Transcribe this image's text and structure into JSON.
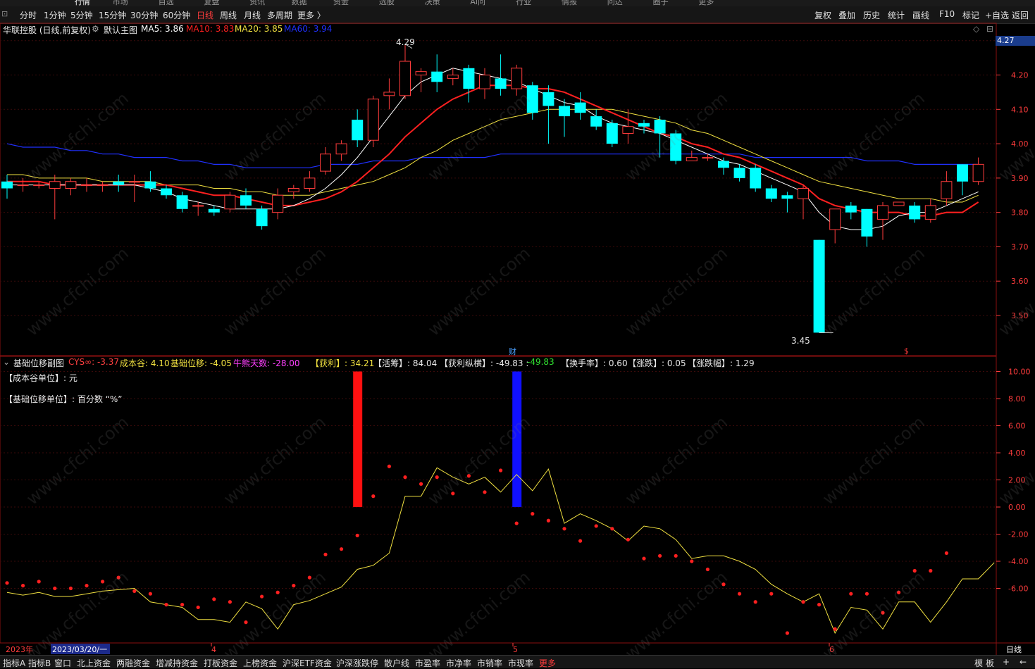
{
  "top_menu": [
    "行情",
    "市场",
    "自选",
    "复盘",
    "资讯",
    "数据",
    "资金",
    "选股",
    "决策",
    "Ai问",
    "行业",
    "情报",
    "问达",
    "圈子",
    "更多"
  ],
  "period_bar": {
    "items": [
      {
        "label": "分时",
        "active": false
      },
      {
        "label": "1分钟",
        "active": false
      },
      {
        "label": "5分钟",
        "active": false
      },
      {
        "label": "15分钟",
        "active": false
      },
      {
        "label": "30分钟",
        "active": false
      },
      {
        "label": "60分钟",
        "active": false
      },
      {
        "label": "日线",
        "active": true
      },
      {
        "label": "周线",
        "active": false
      },
      {
        "label": "月线",
        "active": false
      },
      {
        "label": "多周期",
        "active": false
      },
      {
        "label": "更多 〉",
        "active": false
      }
    ],
    "right": [
      "复权",
      "叠加",
      "历史",
      "统计",
      "画线",
      "F10",
      "标记",
      "+自选",
      "返回"
    ]
  },
  "info_bar": {
    "stock": "华联控股 (日线,前复权)",
    "template": "默认主图",
    "ma5": "MA5: 3.86",
    "ma10": "MA10: 3.83",
    "ma20": "MA20: 3.85",
    "ma60": "MA60: 3.94",
    "ma5_color": "#ffffff",
    "ma10_color": "#ff2020",
    "ma20_color": "#f0e040",
    "ma60_color": "#2030ff"
  },
  "sub_info": {
    "title": "基础位移副图",
    "cys": "CYS∞: -3.37",
    "cost_valley": "成本谷: 4.10",
    "base_shift": "基础位移: -4.05",
    "bear_days": "牛熊天数: -28.00",
    "profit": "【获利】: 34.21",
    "active": "【活筹】: 84.04",
    "profit_vh": "【获利纵横】: -49.83 : ",
    "profit_vh2": "-49.83",
    "turnover": "【换手率】: 0.60",
    "change": "【涨跌】: 0.05",
    "change_pct": "【涨跌幅】: 1.29",
    "unit1": "【成本谷单位】: 元",
    "unit2": "【基础位移单位】: 百分数 “%”"
  },
  "markers": {
    "high": "4.29",
    "low": "3.45",
    "cai": "财",
    "dollar": "$",
    "current_price": "4.27"
  },
  "bottom_bar": {
    "tabs": [
      "指标A",
      "指标B",
      "窗口",
      "北上资金",
      "两融资金",
      "增减持资金",
      "打板资金",
      "上榜资金",
      "沪深ETF资金",
      "沪深涨跌停",
      "散户线",
      "市盈率",
      "市净率",
      "市销率",
      "市现率",
      "更多"
    ],
    "right": [
      "模",
      "板",
      "+",
      "←"
    ]
  },
  "watermark": "www.cfchi.com",
  "chart_data": [
    {
      "type": "candlestick",
      "title": "华联控股 (日线,前复权)",
      "ylim": [
        3.42,
        4.32
      ],
      "yticks": [
        "4.30",
        "4.20",
        "4.10",
        "4.00",
        "3.90",
        "3.80",
        "3.70",
        "3.60",
        "3.50"
      ],
      "ytick_values": [
        4.3,
        4.2,
        4.1,
        4.0,
        3.9,
        3.8,
        3.7,
        3.6,
        3.5
      ],
      "x_labels": [
        "2023年",
        "2023/03/20/一",
        "4",
        "5",
        "6",
        "日线"
      ],
      "candles": [
        [
          3.89,
          3.87,
          3.91,
          3.84
        ],
        [
          3.88,
          3.88,
          3.9,
          3.86
        ],
        [
          3.88,
          3.88,
          3.89,
          3.87
        ],
        [
          3.87,
          3.89,
          3.91,
          3.78
        ],
        [
          3.87,
          3.89,
          3.9,
          3.85
        ],
        [
          3.88,
          3.88,
          3.9,
          3.86
        ],
        [
          3.88,
          3.88,
          3.89,
          3.86
        ],
        [
          3.89,
          3.88,
          3.91,
          3.86
        ],
        [
          3.89,
          3.89,
          3.91,
          3.83
        ],
        [
          3.89,
          3.87,
          3.92,
          3.86
        ],
        [
          3.87,
          3.85,
          3.88,
          3.84
        ],
        [
          3.85,
          3.81,
          3.86,
          3.8
        ],
        [
          3.82,
          3.82,
          3.83,
          3.79
        ],
        [
          3.81,
          3.8,
          3.82,
          3.79
        ],
        [
          3.81,
          3.85,
          3.86,
          3.8
        ],
        [
          3.85,
          3.82,
          3.87,
          3.81
        ],
        [
          3.81,
          3.76,
          3.82,
          3.75
        ],
        [
          3.8,
          3.85,
          3.87,
          3.78
        ],
        [
          3.86,
          3.87,
          3.88,
          3.84
        ],
        [
          3.87,
          3.9,
          3.92,
          3.86
        ],
        [
          3.92,
          3.97,
          3.99,
          3.91
        ],
        [
          3.97,
          4.0,
          4.01,
          3.95
        ],
        [
          4.07,
          4.01,
          4.1,
          3.99
        ],
        [
          4.01,
          4.13,
          4.14,
          3.99
        ],
        [
          4.14,
          4.15,
          4.19,
          4.1
        ],
        [
          4.14,
          4.24,
          4.29,
          4.13
        ],
        [
          4.2,
          4.21,
          4.22,
          4.15
        ],
        [
          4.21,
          4.18,
          4.26,
          4.15
        ],
        [
          4.19,
          4.2,
          4.22,
          4.17
        ],
        [
          4.22,
          4.16,
          4.23,
          4.12
        ],
        [
          4.16,
          4.2,
          4.22,
          4.13
        ],
        [
          4.19,
          4.16,
          4.26,
          4.14
        ],
        [
          4.16,
          4.22,
          4.23,
          4.14
        ],
        [
          4.17,
          4.09,
          4.18,
          4.07
        ],
        [
          4.15,
          4.11,
          4.17,
          4.0
        ],
        [
          4.11,
          4.08,
          4.13,
          4.02
        ],
        [
          4.12,
          4.09,
          4.15,
          4.07
        ],
        [
          4.08,
          4.05,
          4.1,
          4.04
        ],
        [
          4.06,
          4.0,
          4.07,
          3.99
        ],
        [
          4.03,
          4.05,
          4.1,
          4.0
        ],
        [
          4.06,
          4.05,
          4.07,
          4.03
        ],
        [
          4.07,
          4.03,
          4.08,
          3.96
        ],
        [
          4.03,
          3.95,
          4.04,
          3.94
        ],
        [
          3.95,
          3.96,
          3.98,
          3.95
        ],
        [
          3.96,
          3.96,
          3.97,
          3.95
        ],
        [
          3.95,
          3.93,
          3.96,
          3.91
        ],
        [
          3.93,
          3.9,
          3.94,
          3.89
        ],
        [
          3.93,
          3.87,
          3.94,
          3.86
        ],
        [
          3.87,
          3.84,
          3.88,
          3.83
        ],
        [
          3.85,
          3.84,
          3.86,
          3.8
        ],
        [
          3.84,
          3.87,
          3.88,
          3.78
        ],
        [
          3.72,
          3.45,
          3.72,
          3.45
        ],
        [
          3.75,
          3.81,
          3.81,
          3.71
        ],
        [
          3.82,
          3.8,
          3.83,
          3.78
        ],
        [
          3.81,
          3.73,
          3.81,
          3.7
        ],
        [
          3.78,
          3.82,
          3.83,
          3.72
        ],
        [
          3.82,
          3.83,
          3.83,
          3.82
        ],
        [
          3.82,
          3.78,
          3.83,
          3.77
        ],
        [
          3.78,
          3.82,
          3.84,
          3.77
        ],
        [
          3.84,
          3.89,
          3.92,
          3.82
        ],
        [
          3.94,
          3.89,
          3.94,
          3.85
        ],
        [
          3.89,
          3.94,
          3.96,
          3.88
        ]
      ],
      "ma5": [
        3.88,
        3.88,
        3.88,
        3.88,
        3.88,
        3.88,
        3.88,
        3.88,
        3.88,
        3.87,
        3.86,
        3.84,
        3.83,
        3.82,
        3.81,
        3.81,
        3.81,
        3.81,
        3.82,
        3.84,
        3.87,
        3.91,
        3.96,
        4.02,
        4.08,
        4.14,
        4.18,
        4.2,
        4.22,
        4.21,
        4.2,
        4.19,
        4.18,
        4.16,
        4.14,
        4.12,
        4.11,
        4.08,
        4.06,
        4.05,
        4.04,
        4.03,
        4.01,
        3.99,
        3.97,
        3.95,
        3.94,
        3.92,
        3.9,
        3.88,
        3.86,
        3.8,
        3.76,
        3.75,
        3.75,
        3.76,
        3.79,
        3.8,
        3.8,
        3.82,
        3.84,
        3.86
      ],
      "ma10": [
        3.89,
        3.89,
        3.89,
        3.88,
        3.88,
        3.88,
        3.88,
        3.88,
        3.88,
        3.88,
        3.88,
        3.87,
        3.86,
        3.85,
        3.85,
        3.84,
        3.83,
        3.82,
        3.82,
        3.83,
        3.84,
        3.86,
        3.89,
        3.93,
        3.97,
        4.02,
        4.06,
        4.1,
        4.13,
        4.15,
        4.17,
        4.17,
        4.17,
        4.16,
        4.16,
        4.15,
        4.13,
        4.11,
        4.09,
        4.07,
        4.05,
        4.03,
        4.02,
        4.0,
        3.99,
        3.97,
        3.96,
        3.94,
        3.92,
        3.9,
        3.88,
        3.84,
        3.82,
        3.81,
        3.8,
        3.8,
        3.8,
        3.79,
        3.79,
        3.8,
        3.8,
        3.83
      ],
      "ma20": [
        3.91,
        3.91,
        3.9,
        3.9,
        3.9,
        3.9,
        3.89,
        3.89,
        3.89,
        3.89,
        3.88,
        3.88,
        3.88,
        3.87,
        3.87,
        3.86,
        3.86,
        3.85,
        3.85,
        3.85,
        3.86,
        3.87,
        3.88,
        3.89,
        3.91,
        3.93,
        3.96,
        3.98,
        4.01,
        4.03,
        4.05,
        4.07,
        4.08,
        4.09,
        4.1,
        4.1,
        4.1,
        4.1,
        4.1,
        4.09,
        4.08,
        4.07,
        4.06,
        4.04,
        4.03,
        4.01,
        3.99,
        3.97,
        3.95,
        3.93,
        3.91,
        3.89,
        3.88,
        3.87,
        3.86,
        3.85,
        3.84,
        3.84,
        3.84,
        3.83,
        3.83,
        3.85
      ],
      "ma60": [
        4.0,
        3.99,
        3.99,
        3.99,
        3.98,
        3.98,
        3.97,
        3.97,
        3.96,
        3.96,
        3.96,
        3.95,
        3.95,
        3.94,
        3.94,
        3.93,
        3.93,
        3.93,
        3.93,
        3.93,
        3.94,
        3.94,
        3.94,
        3.95,
        3.95,
        3.95,
        3.96,
        3.96,
        3.96,
        3.96,
        3.96,
        3.97,
        3.97,
        3.97,
        3.97,
        3.97,
        3.97,
        3.97,
        3.97,
        3.97,
        3.97,
        3.97,
        3.97,
        3.97,
        3.97,
        3.97,
        3.97,
        3.96,
        3.96,
        3.96,
        3.96,
        3.96,
        3.96,
        3.96,
        3.95,
        3.95,
        3.95,
        3.94,
        3.94,
        3.94,
        3.94,
        3.94
      ]
    },
    {
      "type": "line",
      "title": "基础位移副图",
      "ylim": [
        -10.0,
        10.0
      ],
      "yticks": [
        "10.00",
        "8.00",
        "6.00",
        "4.00",
        "2.00",
        "0.00",
        "-2.00",
        "-4.00",
        "-6.00"
      ],
      "ytick_values": [
        10,
        8,
        6,
        4,
        2,
        0,
        -2,
        -4,
        -6
      ],
      "series": [
        {
          "name": "基础位移",
          "color": "#f0e040",
          "values": [
            -6.3,
            -6.5,
            -6.3,
            -6.6,
            -6.6,
            -6.4,
            -6.2,
            -6.1,
            -6.0,
            -7.0,
            -7.2,
            -7.4,
            -8.3,
            -8.3,
            -8.5,
            -7.0,
            -7.5,
            -9.0,
            -7.2,
            -6.9,
            -6.4,
            -5.9,
            -4.6,
            -4.3,
            -3.4,
            0.8,
            0.8,
            2.9,
            2.2,
            1.7,
            2.2,
            1.1,
            2.4,
            1.2,
            2.8,
            -1.2,
            -0.5,
            -1.0,
            -1.6,
            -2.5,
            -1.4,
            -1.6,
            -2.4,
            -3.8,
            -3.6,
            -3.6,
            -4.0,
            -4.6,
            -5.7,
            -6.4,
            -7.0,
            -6.4,
            -9.3,
            -7.4,
            -7.6,
            -9.0,
            -7.0,
            -7.0,
            -8.5,
            -7.0,
            -5.3,
            -5.3,
            -4.1
          ]
        },
        {
          "name": "成本谷",
          "color": "#ff2020",
          "values": [
            -5.6,
            -5.8,
            -5.5,
            -6.0,
            -6.0,
            -5.8,
            -5.5,
            -5.2,
            -6.2,
            -6.4,
            -7.2,
            -7.2,
            -7.4,
            -6.8,
            -7.0,
            -8.5,
            -6.6,
            -6.3,
            -5.8,
            -5.2,
            -3.5,
            -3.1,
            -2.1,
            0.8,
            3.0,
            2.2,
            1.7,
            2.2,
            1.0,
            2.3,
            1.1,
            2.7,
            -1.2,
            -0.5,
            -1.0,
            -1.6,
            -2.5,
            -1.4,
            -1.6,
            -2.4,
            -3.8,
            -3.6,
            -3.6,
            -4.0,
            -4.6,
            -5.7,
            -6.4,
            -7.0,
            -6.4,
            -9.3,
            -7.0,
            -7.2,
            -9.0,
            -6.4,
            -6.4,
            -7.8,
            -6.3,
            -4.7,
            -4.7,
            -3.4
          ],
          "start": 0
        }
      ],
      "bars": [
        {
          "index": 22,
          "value": 10,
          "color": "#ff1010"
        },
        {
          "index": 32,
          "value": 10,
          "color": "#1010ff"
        }
      ]
    }
  ]
}
